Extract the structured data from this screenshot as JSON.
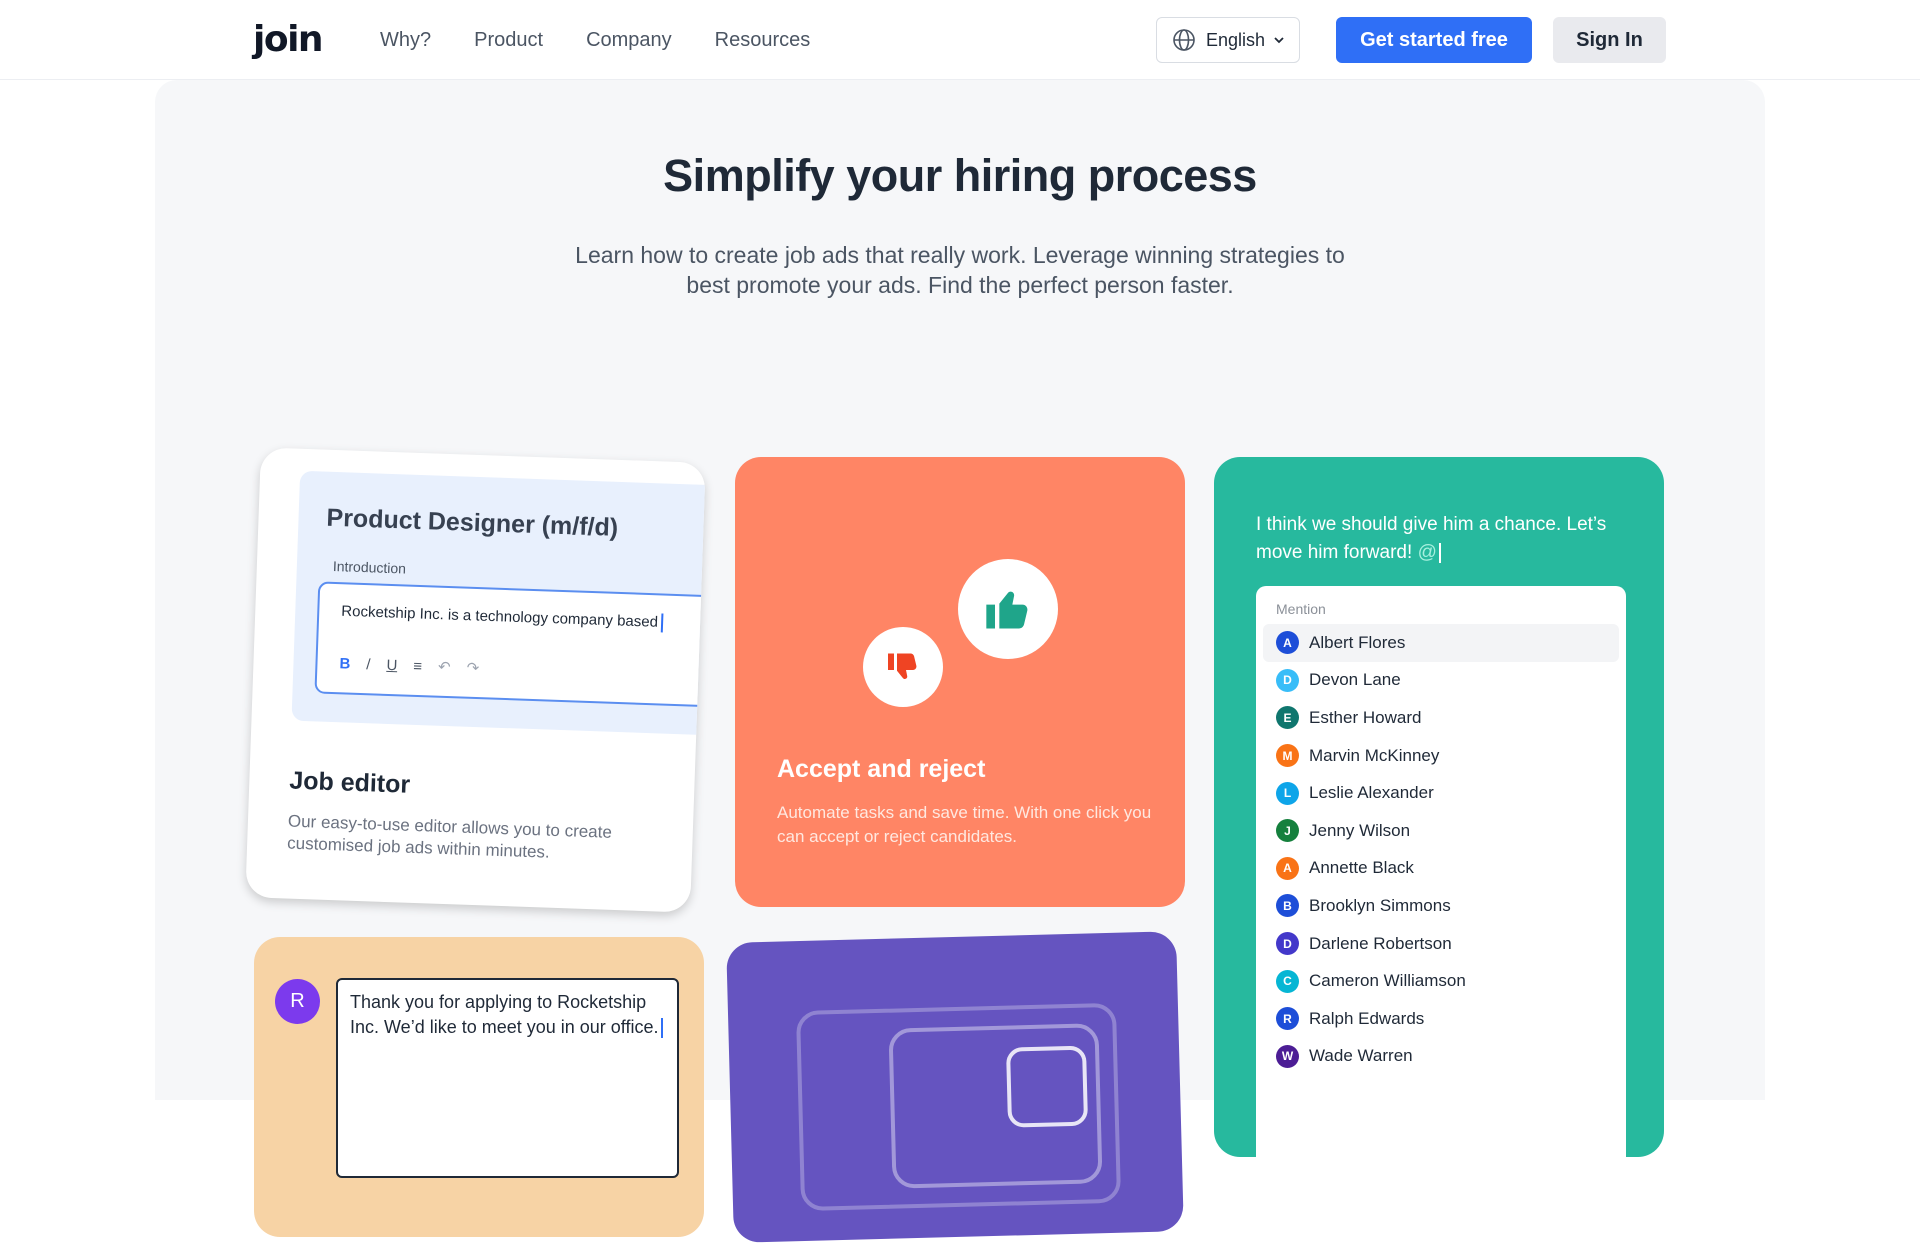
{
  "nav": {
    "logo": "join",
    "links": [
      "Why?",
      "Product",
      "Company",
      "Resources"
    ],
    "language": "English",
    "cta_primary": "Get started free",
    "cta_secondary": "Sign In"
  },
  "hero": {
    "headline": "Simplify your hiring process",
    "subline": "Learn how to create job ads that really work. Leverage winning strategies to best promote your ads. Find the perfect person faster."
  },
  "job_editor_card": {
    "job_title": "Product Designer (m/f/d)",
    "intro_label": "Introduction",
    "editor_text": "Rocketship Inc. is a technology company based",
    "toolbar": [
      "B",
      "/",
      "U",
      "≡",
      "↶",
      "↷"
    ],
    "title": "Job editor",
    "description": "Our easy-to-use editor allows you to create customised job ads within minutes."
  },
  "accept_card": {
    "title": "Accept and reject",
    "description": "Automate tasks and save time. With one click you can accept or reject candidates.",
    "accent_color": "#ff8565"
  },
  "mention_card": {
    "message": "I think we should give him a chance. Let’s move him forward!",
    "at_symbol": "@",
    "panel_label": "Mention",
    "people": [
      {
        "initial": "A",
        "name": "Albert Flores",
        "color": "#1d4ed8"
      },
      {
        "initial": "D",
        "name": "Devon Lane",
        "color": "#38bdf8"
      },
      {
        "initial": "E",
        "name": "Esther Howard",
        "color": "#0f766e"
      },
      {
        "initial": "M",
        "name": "Marvin McKinney",
        "color": "#f97316"
      },
      {
        "initial": "L",
        "name": "Leslie Alexander",
        "color": "#0ea5e9"
      },
      {
        "initial": "J",
        "name": "Jenny Wilson",
        "color": "#15803d"
      },
      {
        "initial": "A",
        "name": "Annette Black",
        "color": "#f97316"
      },
      {
        "initial": "B",
        "name": "Brooklyn Simmons",
        "color": "#1d4ed8"
      },
      {
        "initial": "D",
        "name": "Darlene Robertson",
        "color": "#4338ca"
      },
      {
        "initial": "C",
        "name": "Cameron Williamson",
        "color": "#06b6d4"
      },
      {
        "initial": "R",
        "name": "Ralph Edwards",
        "color": "#1d4ed8"
      },
      {
        "initial": "W",
        "name": "Wade Warren",
        "color": "#4c1d95"
      }
    ],
    "accent_color": "#27b99e"
  },
  "message_card": {
    "avatar_initial": "R",
    "text": "Thank you for applying to Rocketship Inc. We’d like to meet you in our office."
  }
}
